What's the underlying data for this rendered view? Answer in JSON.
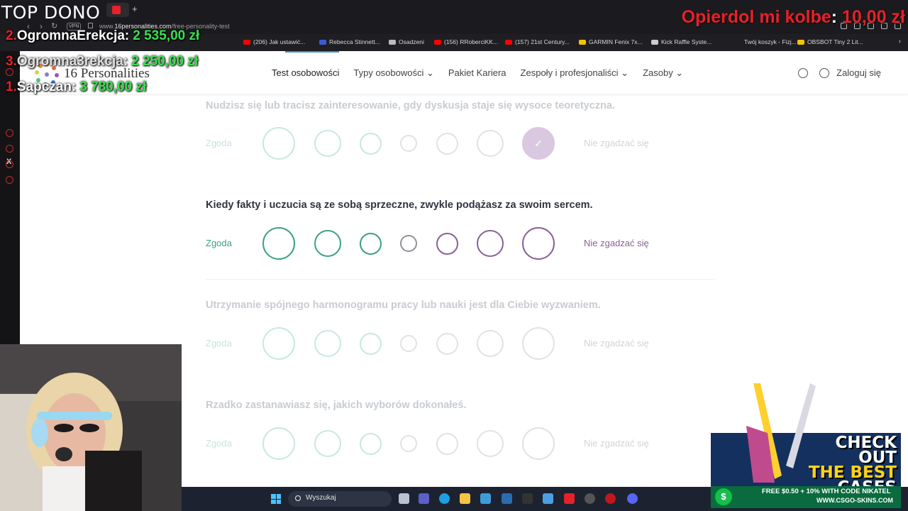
{
  "accent": "#e8202a",
  "browser": {
    "url_prefix": "www.",
    "url_domain": "16personalities.com",
    "url_path": "/free-personality-test",
    "vpn_label": "VPN",
    "new_tab": "+",
    "bookmarks": [
      {
        "label": "(206) Jak ustawić...",
        "icon_color": "#ff0000"
      },
      {
        "label": "Rebecca Stinnett...",
        "icon_color": "#3b5bdb"
      },
      {
        "label": "Osadzeni",
        "icon_color": "#bbbbbb"
      },
      {
        "label": "(156) RRoberciKK...",
        "icon_color": "#ff0000"
      },
      {
        "label": "(157) 21st Century...",
        "icon_color": "#ff0000"
      },
      {
        "label": "GARMIN Fenix 7x...",
        "icon_color": "#f5c400"
      },
      {
        "label": "Kick Raffle Syste...",
        "icon_color": "#cccccc"
      },
      {
        "label": "Twój koszyk - Fizj...",
        "icon_color": "#1f1f23"
      },
      {
        "label": "OBSBOT Tiny 2 Lit...",
        "icon_color": "#f5c400"
      }
    ],
    "bookmark_more": "›"
  },
  "site": {
    "logo_text": "16 Personalities",
    "nav": [
      {
        "label": "Test osobowości"
      },
      {
        "label": "Typy osobowości ⌄"
      },
      {
        "label": "Pakiet Kariera"
      },
      {
        "label": "Zespoły i profesjonaliści ⌄"
      },
      {
        "label": "Zasoby ⌄"
      }
    ],
    "login": "Zaloguj się"
  },
  "questions": [
    {
      "text": "Nudzisz się lub tracisz zainteresowanie, gdy dyskusja staje się wysoce teoretyczna.",
      "agree": "Zgoda",
      "disagree": "Nie zgadzać się",
      "selected": 6
    },
    {
      "text": "Kiedy fakty i uczucia są ze sobą sprzeczne, zwykle podążasz za swoim sercem.",
      "agree": "Zgoda",
      "disagree": "Nie zgadzać się",
      "selected": null
    },
    {
      "text": "Utrzymanie spójnego harmonogramu pracy lub nauki jest dla Ciebie wyzwaniem.",
      "agree": "Zgoda",
      "disagree": "Nie zgadzać się",
      "selected": null
    },
    {
      "text": "Rzadko zastanawiasz się, jakich wyborów dokonałeś.",
      "agree": "Zgoda",
      "disagree": "Nie zgadzać się",
      "selected": null
    }
  ],
  "taskbar": {
    "search_label": "Wyszukaj"
  },
  "overlay": {
    "top_title": "TOP DONO",
    "donors": [
      {
        "rank": "2.",
        "name": "OgromnaErekcja:",
        "amount": "2 535,00 zł"
      },
      {
        "rank": "3.",
        "name": "Ogromna3rekcja:",
        "amount": "2 250,00 zł"
      },
      {
        "rank": "1.",
        "name": "Sapczan:",
        "amount": "3 780,00 zł"
      }
    ],
    "goal_label": "Opierdol mi kolbe",
    "goal_sep": ":",
    "goal_amount": "10,00 zł"
  },
  "promo": {
    "line1": "CHECK OUT",
    "line2": "THE BEST",
    "line3": "CASES",
    "code": "FREE $0.50 + 10% WITH CODE NIKATEL",
    "site": "WWW.CSGO-SKINS.COM",
    "coin": "$"
  }
}
